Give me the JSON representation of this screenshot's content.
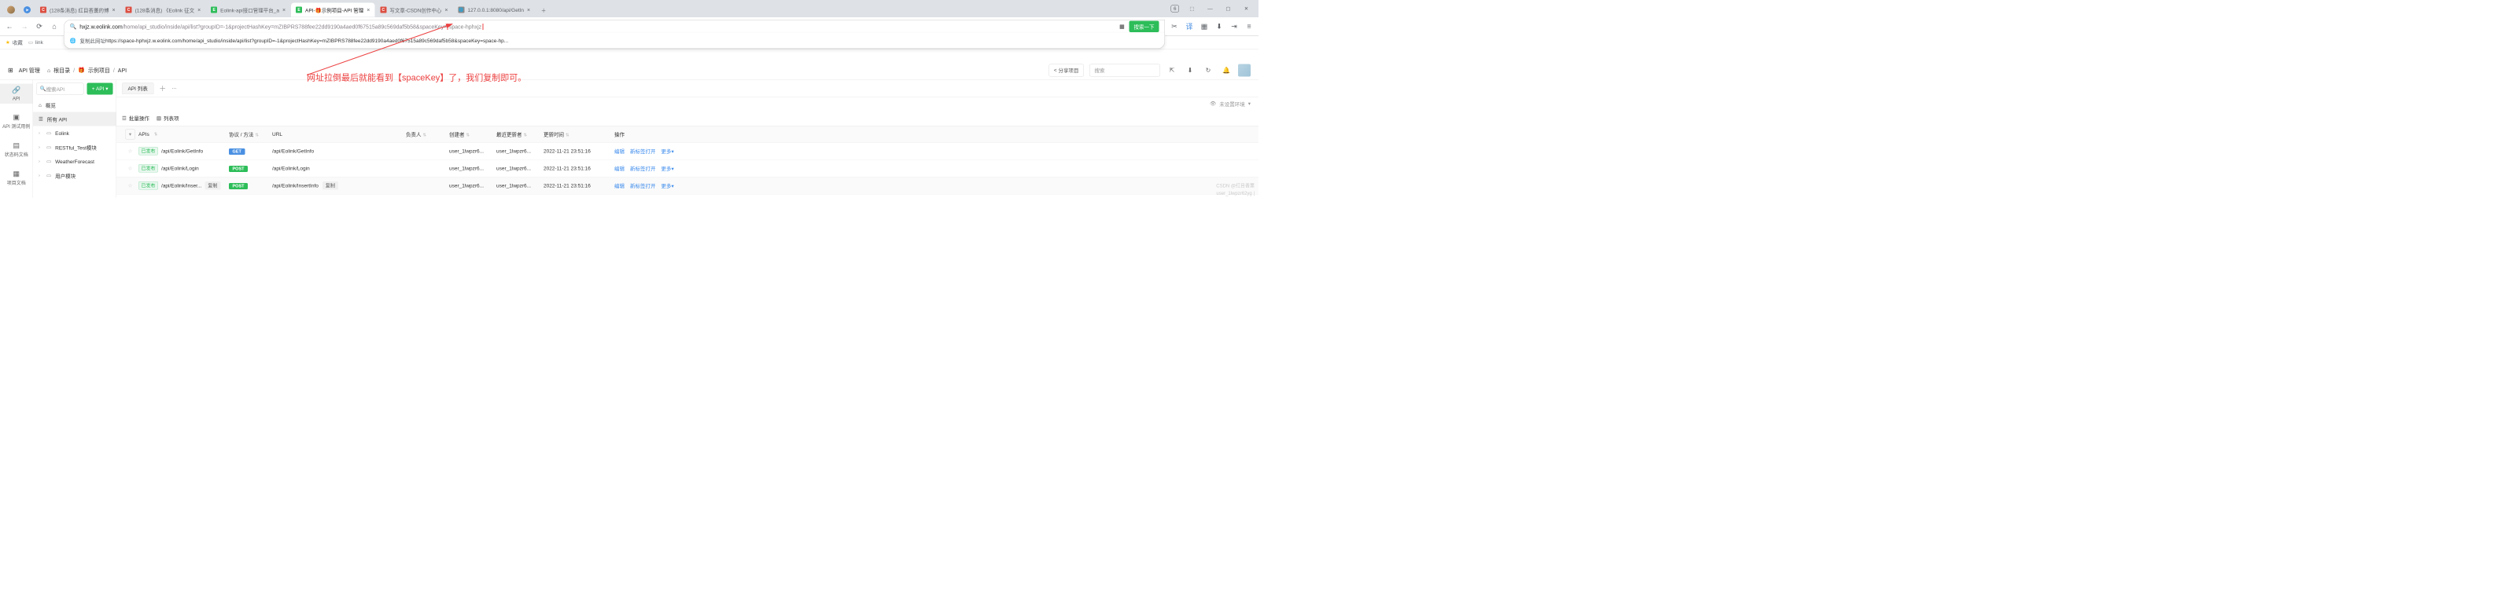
{
  "browser": {
    "tabs": [
      {
        "label": "(128条消息) 红目香薰的博",
        "icon": "#dc4e41",
        "text": "C"
      },
      {
        "label": "(128条消息) 《Eolink 征文",
        "icon": "#dc4e41",
        "text": "C"
      },
      {
        "label": "Eolink-api接口管理平台_a",
        "icon": "#2dbd59",
        "text": "E"
      },
      {
        "label": "API-🎁示例项目-API 管理",
        "icon": "#2dbd59",
        "text": "E",
        "active": true
      },
      {
        "label": "写文章-CSDN创作中心",
        "icon": "#dc4e41",
        "text": "C"
      },
      {
        "label": "127.0.0.1:8080/api/GetIn",
        "icon": "#888",
        "text": "🌐"
      }
    ],
    "tab_counter": "6",
    "url_host": "hxjz.w.eolink.com",
    "url_path": "/home/api_studio/inside/api/list?groupID=-1&projectHashKey=mZIBPRS788fee22dd9190a4aed0f67515a89c569daf5b58&spaceKey=",
    "url_highlight": "space-hphxjz",
    "search_btn": "搜索一下",
    "suggest_prefix": "复制此网址 ",
    "suggest_url": "https://space-hphxjz.w.eolink.com/home/api_studio/inside/api/list?groupID=-1&projectHashKey=mZIBPRS788fee22dd9190a4aed0f67515a89c569daf5b58&spaceKey=space-hp...",
    "bookmarks": {
      "fav": "收藏",
      "link": "link"
    }
  },
  "app": {
    "crumbs": {
      "manage": "API 管理",
      "root": "根目录",
      "project": "示例项目",
      "api": "API"
    },
    "share": "分享项目",
    "search_ph": "搜索",
    "rail": [
      {
        "ic": "🔗",
        "t": "API"
      },
      {
        "ic": "▣",
        "t": "API 测试用例"
      },
      {
        "ic": "▤",
        "t": "状态码文档"
      },
      {
        "ic": "▦",
        "t": "项目文档"
      }
    ],
    "sidebar": {
      "search_ph": "搜索API",
      "add": "+ API ▾",
      "overview": "概览",
      "all": "所有 API",
      "folders": [
        "Eolink",
        "RESTful_Test模块",
        "WeatherForecast",
        "用户模块"
      ]
    },
    "tabs": {
      "list": "API 列表"
    },
    "env": "未设置环境",
    "tablebar": {
      "batch": "批量操作",
      "cols": "列表项"
    },
    "columns": {
      "apis": "APIs",
      "method": "协议 / 方法",
      "url": "URL",
      "owner": "负责人",
      "creator": "创建者",
      "updater": "最近更新者",
      "time": "更新时间",
      "ops": "操作"
    },
    "rows": [
      {
        "status": "已发布",
        "path": "/api/Eolink/GetInfo",
        "method": "GET",
        "url": "/api/Eolink/GetInfo",
        "creator": "user_1lwpzr6...",
        "updater": "user_1lwpzr6...",
        "time": "2022-11-21 23:51:16"
      },
      {
        "status": "已发布",
        "path": "/api/Eolink/Login",
        "method": "POST",
        "url": "/api/Eolink/Login",
        "creator": "user_1lwpzr6...",
        "updater": "user_1lwpzr6...",
        "time": "2022-11-21 23:51:16"
      },
      {
        "status": "已发布",
        "path": "/api/Eolink/Inser...",
        "method": "POST",
        "url": "/api/Eolink/InsertInfo",
        "creator": "user_1lwpzr6...",
        "updater": "user_1lwpzr6...",
        "time": "2022-11-21 23:51:16",
        "copy": true,
        "hover": true
      }
    ],
    "ops": {
      "edit": "编辑",
      "newtab": "新标签打开",
      "more": "更多",
      "copy": "复制"
    }
  },
  "annotation": "网址拉倒最后就能看到【spaceKey】了，我们复制即可。",
  "watermark1": "CSDN @红目香薰",
  "watermark2": "user_1lwpzr62yg |"
}
